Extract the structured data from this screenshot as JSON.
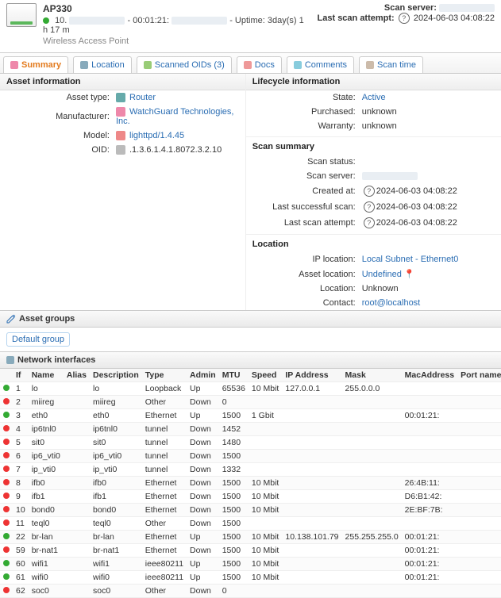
{
  "header": {
    "title": "AP330",
    "status_ip_prefix": "10.",
    "mac_prefix": " - 00:01:21:",
    "uptime_label": " - Uptime: ",
    "uptime": "3day(s) 1 h 17 m",
    "device_type": "Wireless Access Point",
    "scan_server_label": "Scan server:",
    "last_attempt_label": "Last scan attempt:",
    "last_attempt_value": "2024-06-03 04:08:22"
  },
  "tabs": [
    {
      "label": "Summary"
    },
    {
      "label": "Location"
    },
    {
      "label": "Scanned OIDs (3)"
    },
    {
      "label": "Docs"
    },
    {
      "label": "Comments"
    },
    {
      "label": "Scan time"
    }
  ],
  "asset_info": {
    "heading": "Asset information",
    "rows": [
      {
        "k": "Asset type:",
        "v": "Router",
        "link": true,
        "iconClass": "bg-blue"
      },
      {
        "k": "Manufacturer:",
        "v": "WatchGuard Technologies, Inc.",
        "link": true,
        "iconClass": "bg-orange"
      },
      {
        "k": "Model:",
        "v": "lighttpd/1.4.45",
        "link": true,
        "iconClass": "bg-red"
      },
      {
        "k": "OID:",
        "v": ".1.3.6.1.4.1.8072.3.2.10",
        "link": false,
        "iconClass": "bg-grey"
      }
    ]
  },
  "lifecycle": {
    "heading": "Lifecycle information",
    "rows": [
      {
        "k": "State:",
        "v": "Active",
        "link": true
      },
      {
        "k": "Purchased:",
        "v": "unknown"
      },
      {
        "k": "Warranty:",
        "v": "unknown"
      }
    ]
  },
  "scan_summary": {
    "heading": "Scan summary",
    "rows": [
      {
        "k": "Scan status:",
        "v": ""
      },
      {
        "k": "Scan server:",
        "v": "",
        "redacted": true
      },
      {
        "k": "Created at:",
        "v": "2024-06-03 04:08:22",
        "help": true
      },
      {
        "k": "Last successful scan:",
        "v": "2024-06-03 04:08:22",
        "help": true
      },
      {
        "k": "Last scan attempt:",
        "v": "2024-06-03 04:08:22",
        "help": true
      }
    ]
  },
  "location": {
    "heading": "Location",
    "rows": [
      {
        "k": "IP location:",
        "v": "Local Subnet - Ethernet0",
        "link": true
      },
      {
        "k": "Asset location:",
        "v": "Undefined",
        "link": true,
        "pin": true
      },
      {
        "k": "Location:",
        "v": "Unknown"
      },
      {
        "k": "Contact:",
        "v": "root@localhost",
        "link": true
      }
    ]
  },
  "groups": {
    "heading": "Asset groups",
    "default_label": "Default group"
  },
  "nics": {
    "heading": "Network interfaces",
    "columns": [
      "",
      "If",
      "Name",
      "Alias",
      "Description",
      "Type",
      "Admin",
      "MTU",
      "Speed",
      "IP Address",
      "Mask",
      "MacAddress",
      "Port name",
      ""
    ],
    "rows": [
      {
        "c": "g",
        "if": "1",
        "name": "lo",
        "alias": "",
        "desc": "lo",
        "type": "Loopback",
        "admin": "Up",
        "mtu": "65536",
        "speed": "10 Mbit",
        "ip": "127.0.0.1",
        "mask": "255.0.0.0",
        "mac": "",
        "port": ""
      },
      {
        "c": "r",
        "if": "2",
        "name": "miireg",
        "alias": "",
        "desc": "miireg",
        "type": "Other",
        "admin": "Down",
        "mtu": "0",
        "speed": "",
        "ip": "",
        "mask": "",
        "mac": "",
        "port": ""
      },
      {
        "c": "g",
        "if": "3",
        "name": "eth0",
        "alias": "",
        "desc": "eth0",
        "type": "Ethernet",
        "admin": "Up",
        "mtu": "1500",
        "speed": "1 Gbit",
        "ip": "",
        "mask": "",
        "mac": "00:01:21:",
        "port": ""
      },
      {
        "c": "r",
        "if": "4",
        "name": "ip6tnl0",
        "alias": "",
        "desc": "ip6tnl0",
        "type": "tunnel",
        "admin": "Down",
        "mtu": "1452",
        "speed": "",
        "ip": "",
        "mask": "",
        "mac": "",
        "port": ""
      },
      {
        "c": "r",
        "if": "5",
        "name": "sit0",
        "alias": "",
        "desc": "sit0",
        "type": "tunnel",
        "admin": "Down",
        "mtu": "1480",
        "speed": "",
        "ip": "",
        "mask": "",
        "mac": "",
        "port": ""
      },
      {
        "c": "r",
        "if": "6",
        "name": "ip6_vti0",
        "alias": "",
        "desc": "ip6_vti0",
        "type": "tunnel",
        "admin": "Down",
        "mtu": "1500",
        "speed": "",
        "ip": "",
        "mask": "",
        "mac": "",
        "port": ""
      },
      {
        "c": "r",
        "if": "7",
        "name": "ip_vti0",
        "alias": "",
        "desc": "ip_vti0",
        "type": "tunnel",
        "admin": "Down",
        "mtu": "1332",
        "speed": "",
        "ip": "",
        "mask": "",
        "mac": "",
        "port": ""
      },
      {
        "c": "r",
        "if": "8",
        "name": "ifb0",
        "alias": "",
        "desc": "ifb0",
        "type": "Ethernet",
        "admin": "Down",
        "mtu": "1500",
        "speed": "10 Mbit",
        "ip": "",
        "mask": "",
        "mac": "26:4B:11:",
        "port": ""
      },
      {
        "c": "r",
        "if": "9",
        "name": "ifb1",
        "alias": "",
        "desc": "ifb1",
        "type": "Ethernet",
        "admin": "Down",
        "mtu": "1500",
        "speed": "10 Mbit",
        "ip": "",
        "mask": "",
        "mac": "D6:B1:42:",
        "port": ""
      },
      {
        "c": "r",
        "if": "10",
        "name": "bond0",
        "alias": "",
        "desc": "bond0",
        "type": "Ethernet",
        "admin": "Down",
        "mtu": "1500",
        "speed": "10 Mbit",
        "ip": "",
        "mask": "",
        "mac": "2E:BF:7B:",
        "port": ""
      },
      {
        "c": "r",
        "if": "11",
        "name": "teql0",
        "alias": "",
        "desc": "teql0",
        "type": "Other",
        "admin": "Down",
        "mtu": "1500",
        "speed": "",
        "ip": "",
        "mask": "",
        "mac": "",
        "port": ""
      },
      {
        "c": "g",
        "if": "22",
        "name": "br-lan",
        "alias": "",
        "desc": "br-lan",
        "type": "Ethernet",
        "admin": "Up",
        "mtu": "1500",
        "speed": "10 Mbit",
        "ip": "10.138.101.79",
        "mask": "255.255.255.0",
        "mac": "00:01:21:",
        "port": ""
      },
      {
        "c": "r",
        "if": "59",
        "name": "br-nat1",
        "alias": "",
        "desc": "br-nat1",
        "type": "Ethernet",
        "admin": "Down",
        "mtu": "1500",
        "speed": "10 Mbit",
        "ip": "",
        "mask": "",
        "mac": "00:01:21:",
        "port": ""
      },
      {
        "c": "g",
        "if": "60",
        "name": "wifi1",
        "alias": "",
        "desc": "wifi1",
        "type": "ieee80211",
        "admin": "Up",
        "mtu": "1500",
        "speed": "10 Mbit",
        "ip": "",
        "mask": "",
        "mac": "00:01:21:",
        "port": ""
      },
      {
        "c": "g",
        "if": "61",
        "name": "wifi0",
        "alias": "",
        "desc": "wifi0",
        "type": "ieee80211",
        "admin": "Up",
        "mtu": "1500",
        "speed": "10 Mbit",
        "ip": "",
        "mask": "",
        "mac": "00:01:21:",
        "port": ""
      },
      {
        "c": "r",
        "if": "62",
        "name": "soc0",
        "alias": "",
        "desc": "soc0",
        "type": "Other",
        "admin": "Down",
        "mtu": "0",
        "speed": "",
        "ip": "",
        "mask": "",
        "mac": "",
        "port": ""
      }
    ]
  }
}
